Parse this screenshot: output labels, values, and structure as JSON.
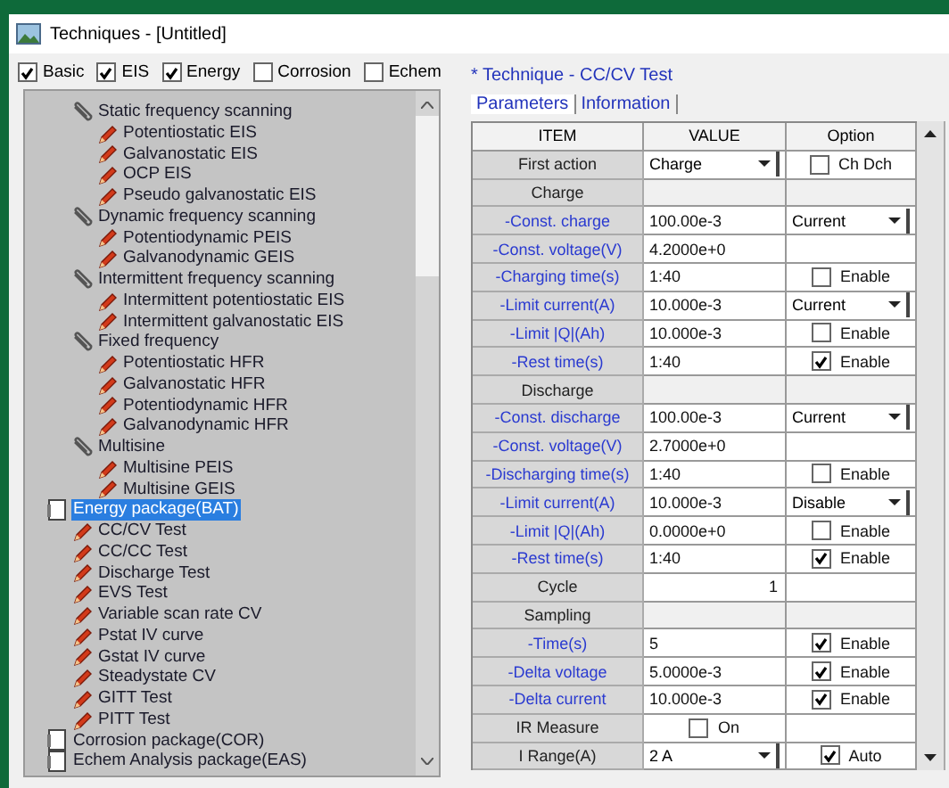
{
  "window": {
    "title": "Techniques - [Untitled]"
  },
  "filters": [
    {
      "label": "Basic",
      "checked": true
    },
    {
      "label": "EIS",
      "checked": true
    },
    {
      "label": "Energy",
      "checked": true
    },
    {
      "label": "Corrosion",
      "checked": false
    },
    {
      "label": "Echem",
      "checked": false
    }
  ],
  "tree": {
    "partial_branch": [
      {
        "label": "Static frequency scanning",
        "kind": "group",
        "selected": false,
        "children": [
          {
            "label": "Potentiostatic EIS",
            "kind": "technique",
            "selected": false
          },
          {
            "label": "Galvanostatic EIS",
            "kind": "technique",
            "selected": false
          },
          {
            "label": "OCP EIS",
            "kind": "technique",
            "selected": false
          },
          {
            "label": "Pseudo galvanostatic EIS",
            "kind": "technique",
            "selected": false
          }
        ]
      },
      {
        "label": "Dynamic frequency scanning",
        "kind": "group",
        "selected": false,
        "children": [
          {
            "label": "Potentiodynamic PEIS",
            "kind": "technique",
            "selected": false
          },
          {
            "label": "Galvanodynamic GEIS",
            "kind": "technique",
            "selected": false
          }
        ]
      },
      {
        "label": "Intermittent frequency scanning",
        "kind": "group",
        "selected": false,
        "children": [
          {
            "label": "Intermittent potentiostatic EIS",
            "kind": "technique",
            "selected": false
          },
          {
            "label": "Intermittent galvanostatic EIS",
            "kind": "technique",
            "selected": false
          }
        ]
      },
      {
        "label": "Fixed frequency",
        "kind": "group",
        "selected": false,
        "children": [
          {
            "label": "Potentiostatic HFR",
            "kind": "technique",
            "selected": false
          },
          {
            "label": "Galvanostatic HFR",
            "kind": "technique",
            "selected": false
          },
          {
            "label": "Potentiodynamic HFR",
            "kind": "technique",
            "selected": false
          },
          {
            "label": "Galvanodynamic HFR",
            "kind": "technique",
            "selected": false
          }
        ]
      },
      {
        "label": "Multisine",
        "kind": "group",
        "selected": false,
        "children": [
          {
            "label": "Multisine PEIS",
            "kind": "technique",
            "selected": false
          },
          {
            "label": "Multisine GEIS",
            "kind": "technique",
            "selected": false
          }
        ]
      }
    ],
    "items": [
      {
        "label": "Energy package(BAT)",
        "kind": "package",
        "selected": true,
        "children": [
          {
            "label": "CC/CV Test",
            "kind": "technique",
            "selected": false
          },
          {
            "label": "CC/CC Test",
            "kind": "technique",
            "selected": false
          },
          {
            "label": "Discharge Test",
            "kind": "technique",
            "selected": false
          },
          {
            "label": "EVS Test",
            "kind": "technique",
            "selected": false
          },
          {
            "label": "Variable scan rate CV",
            "kind": "technique",
            "selected": false
          },
          {
            "label": "Pstat IV curve",
            "kind": "technique",
            "selected": false
          },
          {
            "label": "Gstat IV curve",
            "kind": "technique",
            "selected": false
          },
          {
            "label": "Steadystate CV",
            "kind": "technique",
            "selected": false
          },
          {
            "label": "GITT Test",
            "kind": "technique",
            "selected": false
          },
          {
            "label": "PITT Test",
            "kind": "technique",
            "selected": false
          }
        ]
      },
      {
        "label": "Corrosion package(COR)",
        "kind": "package",
        "selected": false
      },
      {
        "label": "Echem Analysis package(EAS)",
        "kind": "package",
        "selected": false
      }
    ]
  },
  "technique_title": "* Technique - CC/CV Test",
  "tabs": [
    {
      "label": "Parameters",
      "selected": true
    },
    {
      "label": "Information",
      "selected": false
    }
  ],
  "table": {
    "columns": [
      "ITEM",
      "VALUE",
      "Option"
    ],
    "rows": [
      {
        "kind": "setting",
        "item": "First action",
        "value": {
          "kind": "dropdown",
          "text": "Charge"
        },
        "option": {
          "kind": "checkbox",
          "label": "Ch Dch",
          "checked": false
        }
      },
      {
        "kind": "section",
        "item": "Charge"
      },
      {
        "kind": "param",
        "item": "-Const. charge",
        "value": {
          "kind": "text",
          "text": "100.00e-3"
        },
        "option": {
          "kind": "dropdown",
          "text": "Current"
        }
      },
      {
        "kind": "param",
        "item": "-Const. voltage(V)",
        "value": {
          "kind": "text",
          "text": "4.2000e+0"
        }
      },
      {
        "kind": "param",
        "item": "-Charging time(s)",
        "value": {
          "kind": "text",
          "text": "1:40"
        },
        "option": {
          "kind": "checkbox",
          "label": "Enable",
          "checked": false
        }
      },
      {
        "kind": "param",
        "item": "-Limit current(A)",
        "value": {
          "kind": "text",
          "text": "10.000e-3"
        },
        "option": {
          "kind": "dropdown",
          "text": "Current"
        }
      },
      {
        "kind": "param",
        "item": "-Limit |Q|(Ah)",
        "value": {
          "kind": "text",
          "text": "10.000e-3"
        },
        "option": {
          "kind": "checkbox",
          "label": "Enable",
          "checked": false
        }
      },
      {
        "kind": "param",
        "item": "-Rest time(s)",
        "value": {
          "kind": "text",
          "text": "1:40"
        },
        "option": {
          "kind": "checkbox",
          "label": "Enable",
          "checked": true
        }
      },
      {
        "kind": "section",
        "item": "Discharge"
      },
      {
        "kind": "param",
        "item": "-Const. discharge",
        "value": {
          "kind": "text",
          "text": "100.00e-3"
        },
        "option": {
          "kind": "dropdown",
          "text": "Current"
        }
      },
      {
        "kind": "param",
        "item": "-Const. voltage(V)",
        "value": {
          "kind": "text",
          "text": "2.7000e+0"
        }
      },
      {
        "kind": "param",
        "item": "-Discharging time(s)",
        "value": {
          "kind": "text",
          "text": "1:40"
        },
        "option": {
          "kind": "checkbox",
          "label": "Enable",
          "checked": false
        }
      },
      {
        "kind": "param",
        "item": "-Limit current(A)",
        "value": {
          "kind": "text",
          "text": "10.000e-3"
        },
        "option": {
          "kind": "dropdown",
          "text": "Disable"
        }
      },
      {
        "kind": "param",
        "item": "-Limit |Q|(Ah)",
        "value": {
          "kind": "text",
          "text": "0.0000e+0"
        },
        "option": {
          "kind": "checkbox",
          "label": "Enable",
          "checked": false
        }
      },
      {
        "kind": "param",
        "item": "-Rest time(s)",
        "value": {
          "kind": "text",
          "text": "1:40"
        },
        "option": {
          "kind": "checkbox",
          "label": "Enable",
          "checked": true
        }
      },
      {
        "kind": "setting",
        "item": "Cycle",
        "value": {
          "kind": "number",
          "text": "1"
        }
      },
      {
        "kind": "section",
        "item": "Sampling"
      },
      {
        "kind": "param",
        "item": "-Time(s)",
        "value": {
          "kind": "text",
          "text": "5"
        },
        "option": {
          "kind": "checkbox",
          "label": "Enable",
          "checked": true
        }
      },
      {
        "kind": "param",
        "item": "-Delta voltage",
        "value": {
          "kind": "text",
          "text": "5.0000e-3"
        },
        "option": {
          "kind": "checkbox",
          "label": "Enable",
          "checked": true
        }
      },
      {
        "kind": "param",
        "item": "-Delta current",
        "value": {
          "kind": "text",
          "text": "10.000e-3"
        },
        "option": {
          "kind": "checkbox",
          "label": "Enable",
          "checked": true
        }
      },
      {
        "kind": "setting",
        "item": "IR Measure",
        "value": {
          "kind": "checkbox",
          "label": "On",
          "checked": false
        }
      },
      {
        "kind": "setting",
        "item": "I Range(A)",
        "value": {
          "kind": "dropdown",
          "text": "2 A"
        },
        "option": {
          "kind": "checkbox",
          "label": "Auto",
          "checked": true
        }
      }
    ]
  }
}
